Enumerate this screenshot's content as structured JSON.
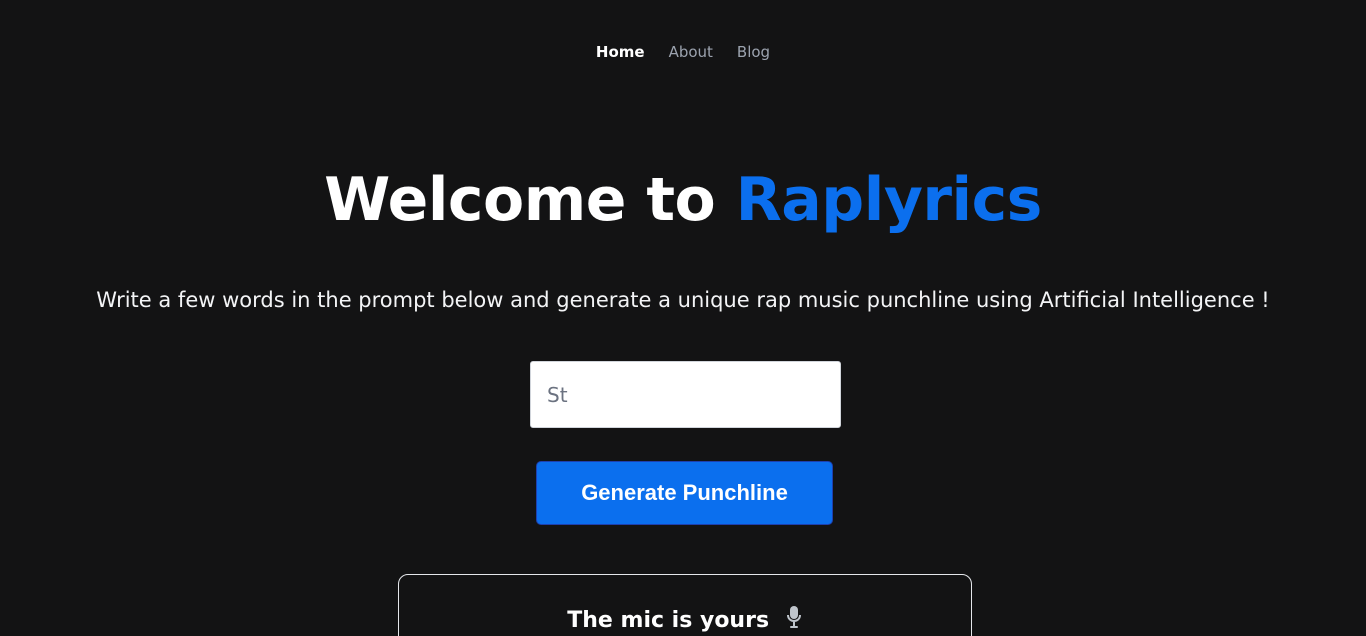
{
  "nav": {
    "items": [
      {
        "label": "Home",
        "active": true
      },
      {
        "label": "About",
        "active": false
      },
      {
        "label": "Blog",
        "active": false
      }
    ]
  },
  "hero": {
    "prefix": "Welcome to",
    "brand": "Raplyrics"
  },
  "subtitle": "Write a few words in the prompt below and generate a unique rap music punchline using Artificial Intelligence !",
  "prompt": {
    "value": "St",
    "placeholder": ""
  },
  "actions": {
    "generate_label": "Generate Punchline"
  },
  "result": {
    "title": "The mic is yours",
    "icon": "microphone-icon"
  },
  "colors": {
    "background": "#131314",
    "accent": "#0b6fee",
    "text": "#ffffff",
    "muted": "#9ca3af"
  }
}
